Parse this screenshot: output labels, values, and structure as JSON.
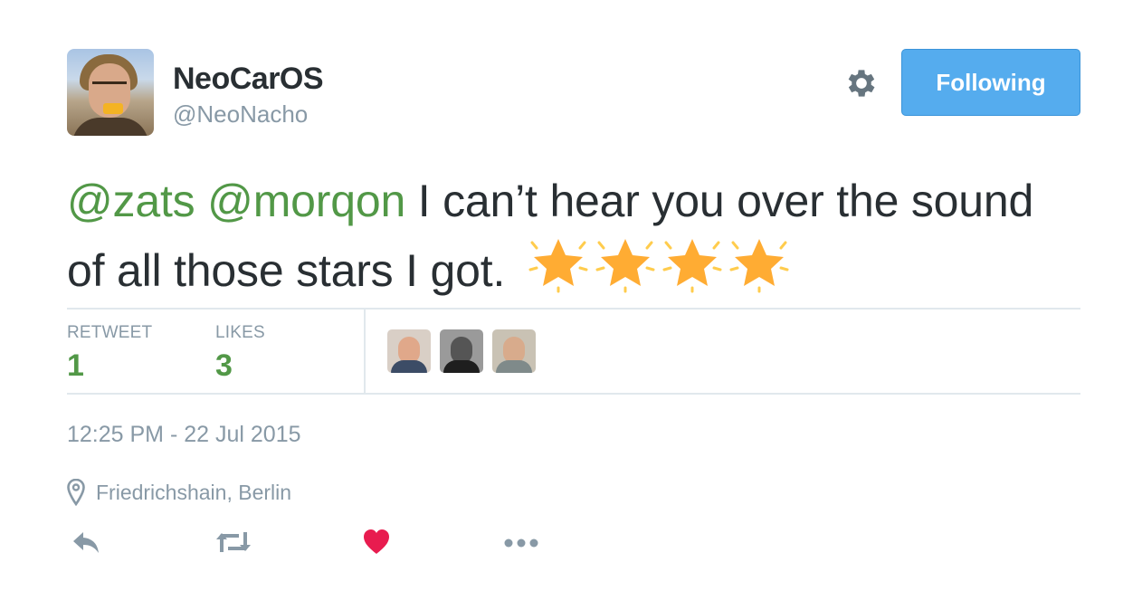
{
  "user": {
    "name": "NeoCarOS",
    "handle": "@NeoNacho"
  },
  "follow_button": {
    "label": "Following"
  },
  "tweet": {
    "mentions": [
      "@zats",
      "@morqon"
    ],
    "text": " I can’t hear you over the sound of all those stars I got.",
    "star_emoji_count": 4
  },
  "stats": {
    "retweet_label": "RETWEET",
    "retweet_count": "1",
    "likes_label": "LIKES",
    "likes_count": "3"
  },
  "likers": [
    {
      "name": "liker-avatar-1"
    },
    {
      "name": "liker-avatar-2"
    },
    {
      "name": "liker-avatar-3"
    }
  ],
  "timestamp": "12:25 PM - 22 Jul 2015",
  "location": "Friedrichshain, Berlin",
  "icons": {
    "settings": "gear-icon",
    "location": "location-pin-icon",
    "reply": "reply-icon",
    "retweet": "retweet-icon",
    "like": "heart-icon",
    "more": "more-icon"
  },
  "colors": {
    "accent_blue": "#55acee",
    "mention_green": "#529847",
    "muted_gray": "#8899a6",
    "like_red": "#e81c4f",
    "star_orange": "#ffac33"
  }
}
